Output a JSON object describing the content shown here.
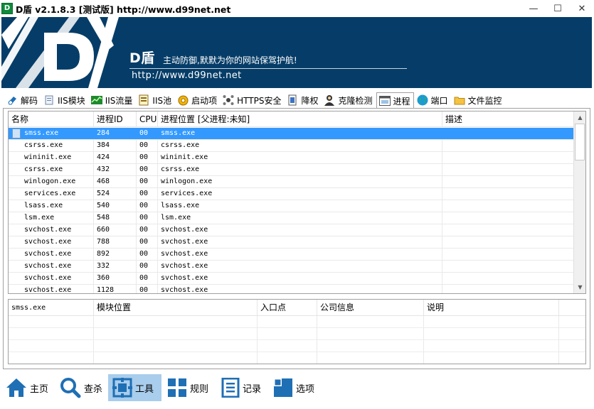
{
  "window": {
    "title": "D盾 v2.1.8.3 [测试版] http://www.d99net.net",
    "app_icon": "D",
    "minimize_glyph": "—",
    "maximize_glyph": "☐",
    "close_glyph": "✕"
  },
  "banner": {
    "brand": "D盾",
    "slogan": "主动防御,默默为你的网站保驾护航!",
    "url": "http://www.d99net.net",
    "logo_letter": "D",
    "background_color": "#063d68"
  },
  "tabs": [
    {
      "label": "解码",
      "icon": "eraser-icon"
    },
    {
      "label": "IIS模块",
      "icon": "module-icon"
    },
    {
      "label": "IIS流量",
      "icon": "traffic-icon"
    },
    {
      "label": "IIS池",
      "icon": "pool-icon"
    },
    {
      "label": "启动项",
      "icon": "gear-icon"
    },
    {
      "label": "HTTPS安全",
      "icon": "network-icon"
    },
    {
      "label": "降权",
      "icon": "downgrade-icon"
    },
    {
      "label": "克隆检测",
      "icon": "user-icon"
    },
    {
      "label": "进程",
      "icon": "process-icon"
    },
    {
      "label": "端口",
      "icon": "globe-icon"
    },
    {
      "label": "文件监控",
      "icon": "folder-icon"
    }
  ],
  "active_tab": "进程",
  "process_table": {
    "headers": [
      "名称",
      "进程ID",
      "CPU",
      "进程位置  [父进程:未知]",
      "描述"
    ],
    "rows": [
      {
        "name": "smss.exe",
        "pid": "284",
        "cpu": "00",
        "path": "smss.exe",
        "desc": ""
      },
      {
        "name": "csrss.exe",
        "pid": "384",
        "cpu": "00",
        "path": "csrss.exe",
        "desc": ""
      },
      {
        "name": "wininit.exe",
        "pid": "424",
        "cpu": "00",
        "path": "wininit.exe",
        "desc": ""
      },
      {
        "name": "csrss.exe",
        "pid": "432",
        "cpu": "00",
        "path": "csrss.exe",
        "desc": ""
      },
      {
        "name": "winlogon.exe",
        "pid": "468",
        "cpu": "00",
        "path": "winlogon.exe",
        "desc": ""
      },
      {
        "name": "services.exe",
        "pid": "524",
        "cpu": "00",
        "path": "services.exe",
        "desc": ""
      },
      {
        "name": "lsass.exe",
        "pid": "540",
        "cpu": "00",
        "path": "lsass.exe",
        "desc": ""
      },
      {
        "name": "lsm.exe",
        "pid": "548",
        "cpu": "00",
        "path": "lsm.exe",
        "desc": ""
      },
      {
        "name": "svchost.exe",
        "pid": "660",
        "cpu": "00",
        "path": "svchost.exe",
        "desc": ""
      },
      {
        "name": "svchost.exe",
        "pid": "788",
        "cpu": "00",
        "path": "svchost.exe",
        "desc": ""
      },
      {
        "name": "svchost.exe",
        "pid": "892",
        "cpu": "00",
        "path": "svchost.exe",
        "desc": ""
      },
      {
        "name": "svchost.exe",
        "pid": "332",
        "cpu": "00",
        "path": "svchost.exe",
        "desc": ""
      },
      {
        "name": "svchost.exe",
        "pid": "360",
        "cpu": "00",
        "path": "svchost.exe",
        "desc": ""
      },
      {
        "name": "svchost.exe",
        "pid": "1128",
        "cpu": "00",
        "path": "svchost.exe",
        "desc": ""
      }
    ],
    "selected_row": "smss.exe",
    "scroll_up": "▲",
    "scroll_down": "▼"
  },
  "module_table": {
    "headers": [
      "smss.exe",
      "模块位置",
      "入口点",
      "公司信息",
      "说明",
      ""
    ]
  },
  "bottom_nav": [
    {
      "label": "主页",
      "icon": "home-icon"
    },
    {
      "label": "查杀",
      "icon": "search-icon"
    },
    {
      "label": "工具",
      "icon": "tools-icon"
    },
    {
      "label": "规则",
      "icon": "rules-icon"
    },
    {
      "label": "记录",
      "icon": "log-icon"
    },
    {
      "label": "选项",
      "icon": "options-icon"
    }
  ],
  "active_nav": "工具",
  "colors": {
    "banner": "#063d68",
    "selection": "#3399ff",
    "nav_active": "#a9cdec",
    "nav_icon": "#1f6fb5"
  }
}
